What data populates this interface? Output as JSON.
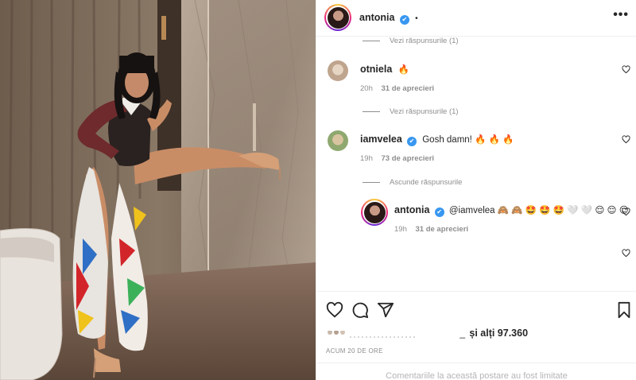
{
  "header": {
    "username": "antonia",
    "verified_mark": "✔",
    "dot": "•",
    "more_label": "•••"
  },
  "comments": {
    "replies_top": "Vezi răspunsurile (1)",
    "items": [
      {
        "username": "otniela",
        "text": "🔥",
        "age": "20h",
        "likes": "31 de aprecieri",
        "replies": "Vezi răspunsurile (1)"
      },
      {
        "username": "iamvelea",
        "text": "Gosh damn! 🔥 🔥 🔥",
        "age": "19h",
        "likes": "73 de aprecieri",
        "replies": "Ascunde răspunsurile"
      }
    ],
    "reply": {
      "username": "antonia",
      "text": "@iamvelea 🙈 🙈 🤩 🤩 🤩 🤍 🤍 😌 😌 😌",
      "age": "19h",
      "likes": "31 de aprecieri"
    }
  },
  "actions": {
    "icons": [
      "heart-icon",
      "comment-icon",
      "share-icon",
      "bookmark-icon"
    ],
    "likes_suffix": "și alți 97.360",
    "likes_underscore": "_",
    "timestamp": "ACUM 20 DE ORE"
  },
  "footer": {
    "text": "Comentariile la această postare au fost limitate"
  },
  "colors": {
    "verified": "#3897f0",
    "muted": "#8e8e8e",
    "text": "#262626"
  }
}
